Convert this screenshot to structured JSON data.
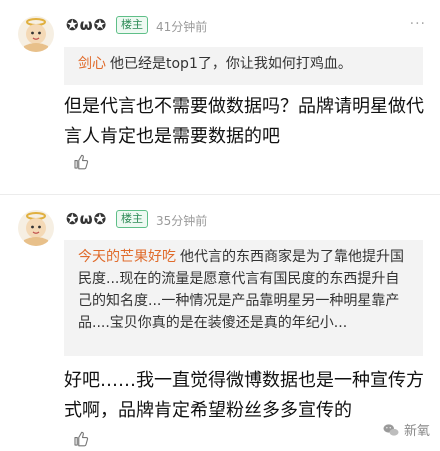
{
  "comments": [
    {
      "username": "✪ω✪",
      "badge": "楼主",
      "time": "41分钟前",
      "more": "···",
      "quote_author": "剑心",
      "quote_text": "他已经是top1了，你让我如何打鸡血。",
      "body": "但是代言也不需要做数据吗？品牌请明星做代言人肯定也是需要数据的吧",
      "like_icon": "thumb-up-icon"
    },
    {
      "username": "✪ω✪",
      "badge": "楼主",
      "time": "35分钟前",
      "quote_author": "今天的芒果好吃",
      "quote_text": "他代言的东西商家是为了靠他提升国民度...现在的流量是愿意代言有国民度的东西提升自己的知名度...一种情况是产品靠明星另一种明星靠产品....宝贝你真的是在装傻还是真的年纪小...",
      "body": "好吧……我一直觉得微博数据也是一种宣传方式啊，品牌肯定希望粉丝多多宣传的",
      "like_icon": "thumb-up-icon"
    }
  ],
  "watermark": {
    "text": "新氧",
    "icon": "wechat-icon"
  },
  "colors": {
    "badge_green": "#2e8b57",
    "quote_author_orange": "#e06b2b",
    "quote_bg": "#f3f3f3"
  }
}
